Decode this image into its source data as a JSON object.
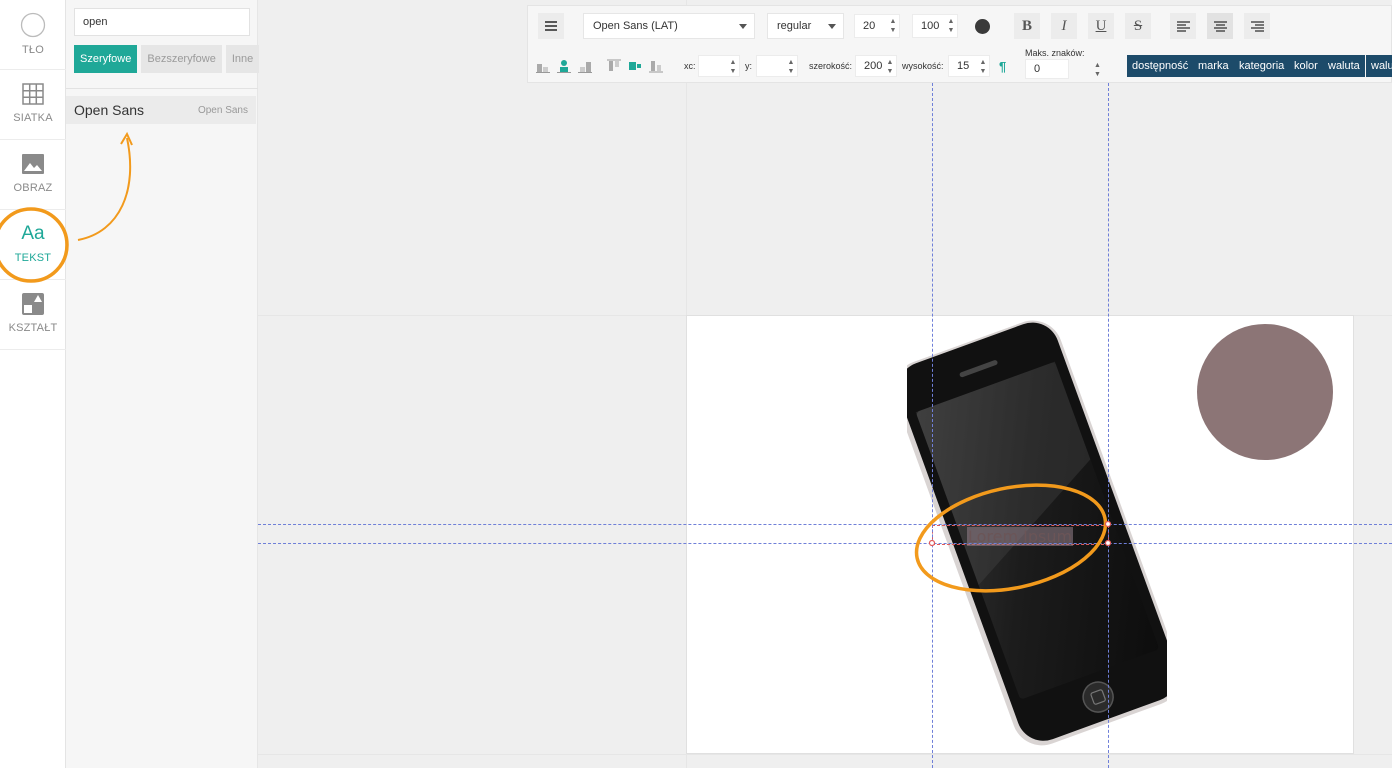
{
  "rail": {
    "items": [
      {
        "label": "TŁO",
        "icon": "circle-icon"
      },
      {
        "label": "SIATKA",
        "icon": "grid-icon"
      },
      {
        "label": "OBRAZ",
        "icon": "image-icon"
      },
      {
        "label": "TEKST",
        "icon": "text-icon",
        "glyph": "Aa",
        "active": true
      },
      {
        "label": "KSZTAŁT",
        "icon": "shape-icon"
      }
    ]
  },
  "font_panel": {
    "search_value": "open",
    "filters": [
      {
        "label": "Szeryfowe",
        "active": true
      },
      {
        "label": "Bezszeryfowe",
        "active": false
      },
      {
        "label": "Inne",
        "active": false
      }
    ],
    "results": [
      {
        "name": "Open Sans",
        "preview": "Open Sans"
      }
    ]
  },
  "toolbar": {
    "font_family": "Open Sans (LAT)",
    "font_weight": "regular",
    "font_size": "20",
    "line_height": "100",
    "bold": "B",
    "italic": "I",
    "underline": "U",
    "strike": "S",
    "xc_label": "xc:",
    "xc_value": "",
    "y_label": "y:",
    "y_value": "",
    "width_label": "szerokość:",
    "width_value": "200",
    "height_label": "wysokość:",
    "height_value": "15",
    "max_chars_label": "Maks. znaków:",
    "max_chars_value": "0",
    "tags": [
      "dostępność",
      "marka",
      "kategoria",
      "kolor",
      "waluta",
      "walut"
    ]
  },
  "canvas": {
    "text_content": "Lorem Ipsum"
  },
  "colors": {
    "accent": "#1fa898",
    "tag_bg": "#1d4b6a",
    "annotation": "#f29a1c",
    "circle_fill": "#8c7576"
  }
}
